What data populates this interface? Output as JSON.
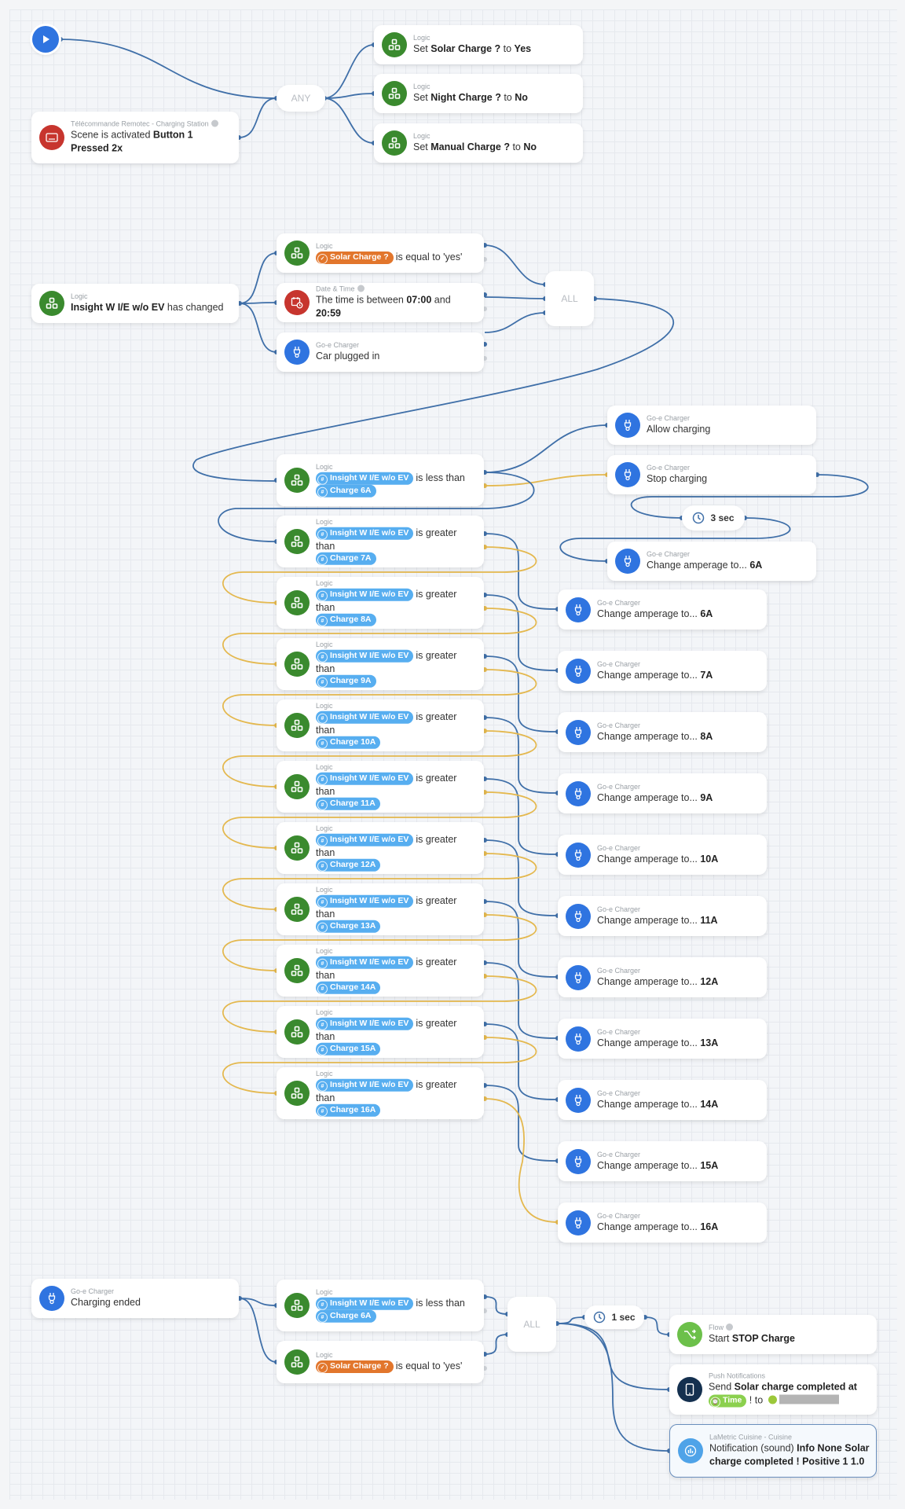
{
  "canvas": {
    "wire_blue": "#3f6fa8",
    "wire_orange": "#e4b84e",
    "section1": {
      "trigger_remote": {
        "category": "Télécommande Remotec - Charging Station",
        "text_plain": "Scene is activated ",
        "text_bold": "Button 1 Pressed 2x"
      },
      "gate_label": "ANY",
      "actions": [
        {
          "category": "Logic",
          "pre": "Set ",
          "var": "Solar Charge ?",
          "mid": " to ",
          "val": "Yes"
        },
        {
          "category": "Logic",
          "pre": "Set ",
          "var": "Night Charge ?",
          "mid": " to ",
          "val": "No"
        },
        {
          "category": "Logic",
          "pre": "Set ",
          "var": "Manual Charge ?",
          "mid": " to ",
          "val": "No"
        }
      ]
    },
    "section2": {
      "trigger": {
        "category": "Logic",
        "bold": "Insight W I/E w/o EV",
        "plain": " has changed"
      },
      "conditions": [
        {
          "category": "Logic",
          "pill": "Solar Charge ?",
          "text": "is equal to 'yes'"
        },
        {
          "category": "Date & Time",
          "text_plain": "The time is between ",
          "from": "07:00",
          "and": " and ",
          "to": "20:59"
        },
        {
          "category": "Go-e Charger",
          "text": "Car plugged in"
        }
      ],
      "gate_label": "ALL",
      "allow": {
        "category": "Go-e Charger",
        "text": "Allow charging"
      },
      "stop": {
        "category": "Go-e Charger",
        "text": "Stop charging"
      },
      "delay": "3 sec",
      "change_after_stop": {
        "category": "Go-e Charger",
        "text": "Change amperage to... ",
        "val": "6A"
      },
      "chain": [
        {
          "category": "Logic",
          "var": "Insight W I/E w/o EV",
          "op": "is less than",
          "ref": "Charge 6A"
        },
        {
          "category": "Logic",
          "var": "Insight W I/E w/o EV",
          "op": "is greater than",
          "ref": "Charge 7A"
        },
        {
          "category": "Logic",
          "var": "Insight W I/E w/o EV",
          "op": "is greater than",
          "ref": "Charge 8A"
        },
        {
          "category": "Logic",
          "var": "Insight W I/E w/o EV",
          "op": "is greater than",
          "ref": "Charge 9A"
        },
        {
          "category": "Logic",
          "var": "Insight W I/E w/o EV",
          "op": "is greater than",
          "ref": "Charge 10A"
        },
        {
          "category": "Logic",
          "var": "Insight W I/E w/o EV",
          "op": "is greater than",
          "ref": "Charge 11A"
        },
        {
          "category": "Logic",
          "var": "Insight W I/E w/o EV",
          "op": "is greater than",
          "ref": "Charge 12A"
        },
        {
          "category": "Logic",
          "var": "Insight W I/E w/o EV",
          "op": "is greater than",
          "ref": "Charge 13A"
        },
        {
          "category": "Logic",
          "var": "Insight W I/E w/o EV",
          "op": "is greater than",
          "ref": "Charge 14A"
        },
        {
          "category": "Logic",
          "var": "Insight W I/E w/o EV",
          "op": "is greater than",
          "ref": "Charge 15A"
        },
        {
          "category": "Logic",
          "var": "Insight W I/E w/o EV",
          "op": "is greater than",
          "ref": "Charge 16A"
        }
      ],
      "amperage": [
        {
          "category": "Go-e Charger",
          "text": "Change amperage to... ",
          "val": "6A"
        },
        {
          "category": "Go-e Charger",
          "text": "Change amperage to... ",
          "val": "7A"
        },
        {
          "category": "Go-e Charger",
          "text": "Change amperage to... ",
          "val": "8A"
        },
        {
          "category": "Go-e Charger",
          "text": "Change amperage to... ",
          "val": "9A"
        },
        {
          "category": "Go-e Charger",
          "text": "Change amperage to... ",
          "val": "10A"
        },
        {
          "category": "Go-e Charger",
          "text": "Change amperage to... ",
          "val": "11A"
        },
        {
          "category": "Go-e Charger",
          "text": "Change amperage to... ",
          "val": "12A"
        },
        {
          "category": "Go-e Charger",
          "text": "Change amperage to... ",
          "val": "13A"
        },
        {
          "category": "Go-e Charger",
          "text": "Change amperage to... ",
          "val": "14A"
        },
        {
          "category": "Go-e Charger",
          "text": "Change amperage to... ",
          "val": "15A"
        },
        {
          "category": "Go-e Charger",
          "text": "Change amperage to... ",
          "val": "16A"
        }
      ]
    },
    "section3": {
      "trigger": {
        "category": "Go-e Charger",
        "text": "Charging ended"
      },
      "cond1": {
        "category": "Logic",
        "var": "Insight W I/E w/o EV",
        "op": "is less than",
        "ref": "Charge 6A"
      },
      "cond2": {
        "category": "Logic",
        "pill": "Solar Charge ?",
        "text": "is equal to 'yes'"
      },
      "gate_label": "ALL",
      "delay": "1 sec",
      "flow": {
        "category": "Flow",
        "pre": "Start ",
        "bold": "STOP Charge"
      },
      "push": {
        "category": "Push Notifications",
        "pre": "Send ",
        "bold": "Solar charge completed at",
        "pill": "Time",
        "post": " ! to "
      },
      "lametric": {
        "category": "LaMetric Cuisine - Cuisine",
        "pre": "Notification (sound) ",
        "bold": "Info None Solar charge completed ! Positive 1 1.0"
      }
    }
  }
}
